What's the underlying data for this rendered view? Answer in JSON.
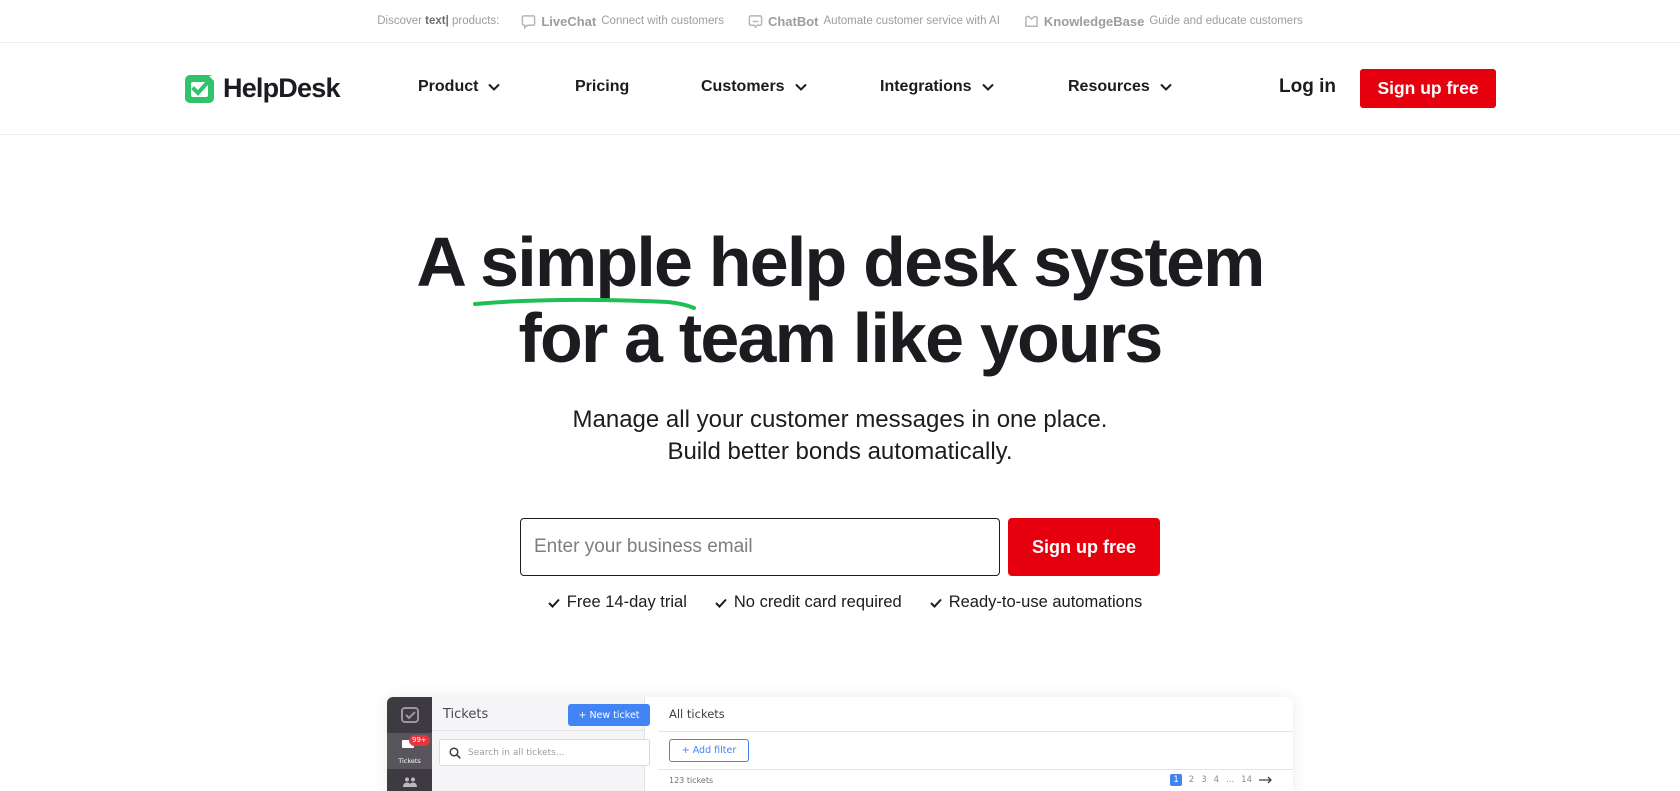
{
  "topbar": {
    "discover_prefix": "Discover",
    "discover_brand": "text|",
    "discover_suffix": "products:",
    "products": [
      {
        "icon": "livechat-icon",
        "name": "LiveChat",
        "desc": "Connect with customers"
      },
      {
        "icon": "chatbot-icon",
        "name": "ChatBot",
        "desc": "Automate customer service with AI"
      },
      {
        "icon": "knowledgebase-icon",
        "name": "KnowledgeBase",
        "desc": "Guide and educate customers"
      }
    ]
  },
  "nav": {
    "logo_text": "HelpDesk",
    "brand_color": "#2fc36c",
    "items": [
      {
        "label": "Product",
        "dropdown": true
      },
      {
        "label": "Pricing",
        "dropdown": false
      },
      {
        "label": "Customers",
        "dropdown": true
      },
      {
        "label": "Integrations",
        "dropdown": true
      },
      {
        "label": "Resources",
        "dropdown": true
      }
    ],
    "login": "Log in",
    "signup": "Sign up free"
  },
  "hero": {
    "title_pre": "A",
    "title_highlight": "simple",
    "title_post": "help desk system",
    "title_line2": "for a team like yours",
    "subtitle_line1": "Manage all your customer messages in one place.",
    "subtitle_line2": "Build better bonds automatically.",
    "email_placeholder": "Enter your business email",
    "cta": "Sign up free",
    "cta_color": "#e6000e",
    "perks": [
      "Free 14-day trial",
      "No credit card required",
      "Ready-to-use automations"
    ]
  },
  "preview": {
    "sidebar": {
      "tickets_label": "Tickets",
      "tickets_badge": "99+"
    },
    "list": {
      "title": "Tickets",
      "new_ticket": "+ New ticket",
      "search_placeholder": "Search in all tickets..."
    },
    "main": {
      "title": "All tickets",
      "add_filter": "+ Add filter",
      "count": "123 tickets",
      "pages": [
        "1",
        "2",
        "3",
        "4",
        "...",
        "14"
      ],
      "active_page": "1"
    }
  }
}
